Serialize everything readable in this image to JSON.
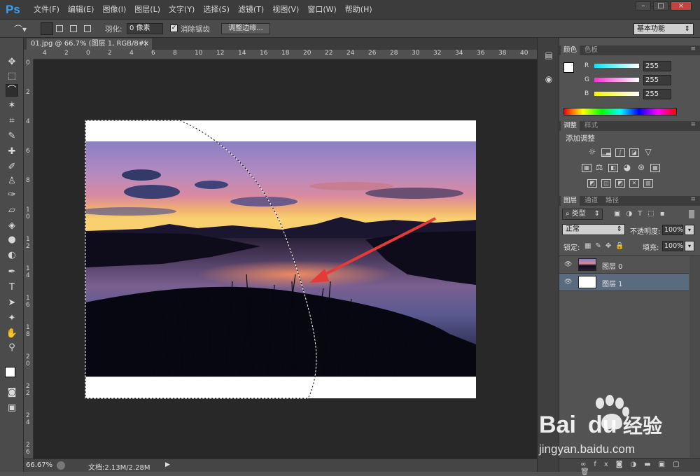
{
  "app": {
    "logo": "Ps"
  },
  "menu": [
    "文件(F)",
    "编辑(E)",
    "图像(I)",
    "图层(L)",
    "文字(Y)",
    "选择(S)",
    "滤镜(T)",
    "视图(V)",
    "窗口(W)",
    "帮助(H)"
  ],
  "window_controls": {
    "minimize": "–",
    "restore": "□",
    "close": "×"
  },
  "options": {
    "feather_label": "羽化:",
    "feather_value": "0 像素",
    "antialias_label": "消除锯齿",
    "antialias_checked": true,
    "refine_edge": "调整边缘...",
    "workspace": "基本功能"
  },
  "document": {
    "tab_title": "01.jpg @ 66.7% (图层 1, RGB/8#) *",
    "tab_close": "×",
    "zoom": "66.67%",
    "doc_info": "文档:2.13M/2.28M",
    "ruler_top": [
      "4",
      "2",
      "0",
      "2",
      "4",
      "6",
      "8",
      "10",
      "12",
      "14",
      "16",
      "18",
      "20",
      "22",
      "24",
      "26",
      "28",
      "30",
      "32",
      "34",
      "36",
      "38",
      "40"
    ],
    "ruler_left": [
      "0",
      "2",
      "4",
      "6",
      "8",
      "1 0",
      "1 2",
      "1 4",
      "1 6",
      "1 8",
      "2 0",
      "2 2",
      "2 4",
      "2 6"
    ]
  },
  "color_panel": {
    "tabs": [
      "颜色",
      "色板"
    ],
    "channels": [
      {
        "label": "R",
        "value": "255",
        "color": "#00e5ff"
      },
      {
        "label": "G",
        "value": "255",
        "color": "#ff2bd6"
      },
      {
        "label": "B",
        "value": "255",
        "color": "#f5f500"
      }
    ]
  },
  "adjustments_panel": {
    "tabs": [
      "调整",
      "样式"
    ],
    "heading": "添加调整"
  },
  "layers_panel": {
    "tabs": [
      "图层",
      "通道",
      "路径"
    ],
    "filter_kind": "类型",
    "blend_mode": "正常",
    "opacity_label": "不透明度:",
    "opacity_value": "100%",
    "lock_label": "锁定:",
    "fill_label": "填充:",
    "fill_value": "100%",
    "layers": [
      {
        "name": "图层 0",
        "selected": false
      },
      {
        "name": "图层 1",
        "selected": true
      }
    ]
  },
  "watermark": {
    "brand": "Bai",
    "brand2": "du",
    "suffix": "经验",
    "url": "jingyan.baidu.com"
  },
  "colors": {
    "accent": "#3fa0f0",
    "selection_bg": "#5a6b80",
    "canvas_bg": "#282828"
  }
}
